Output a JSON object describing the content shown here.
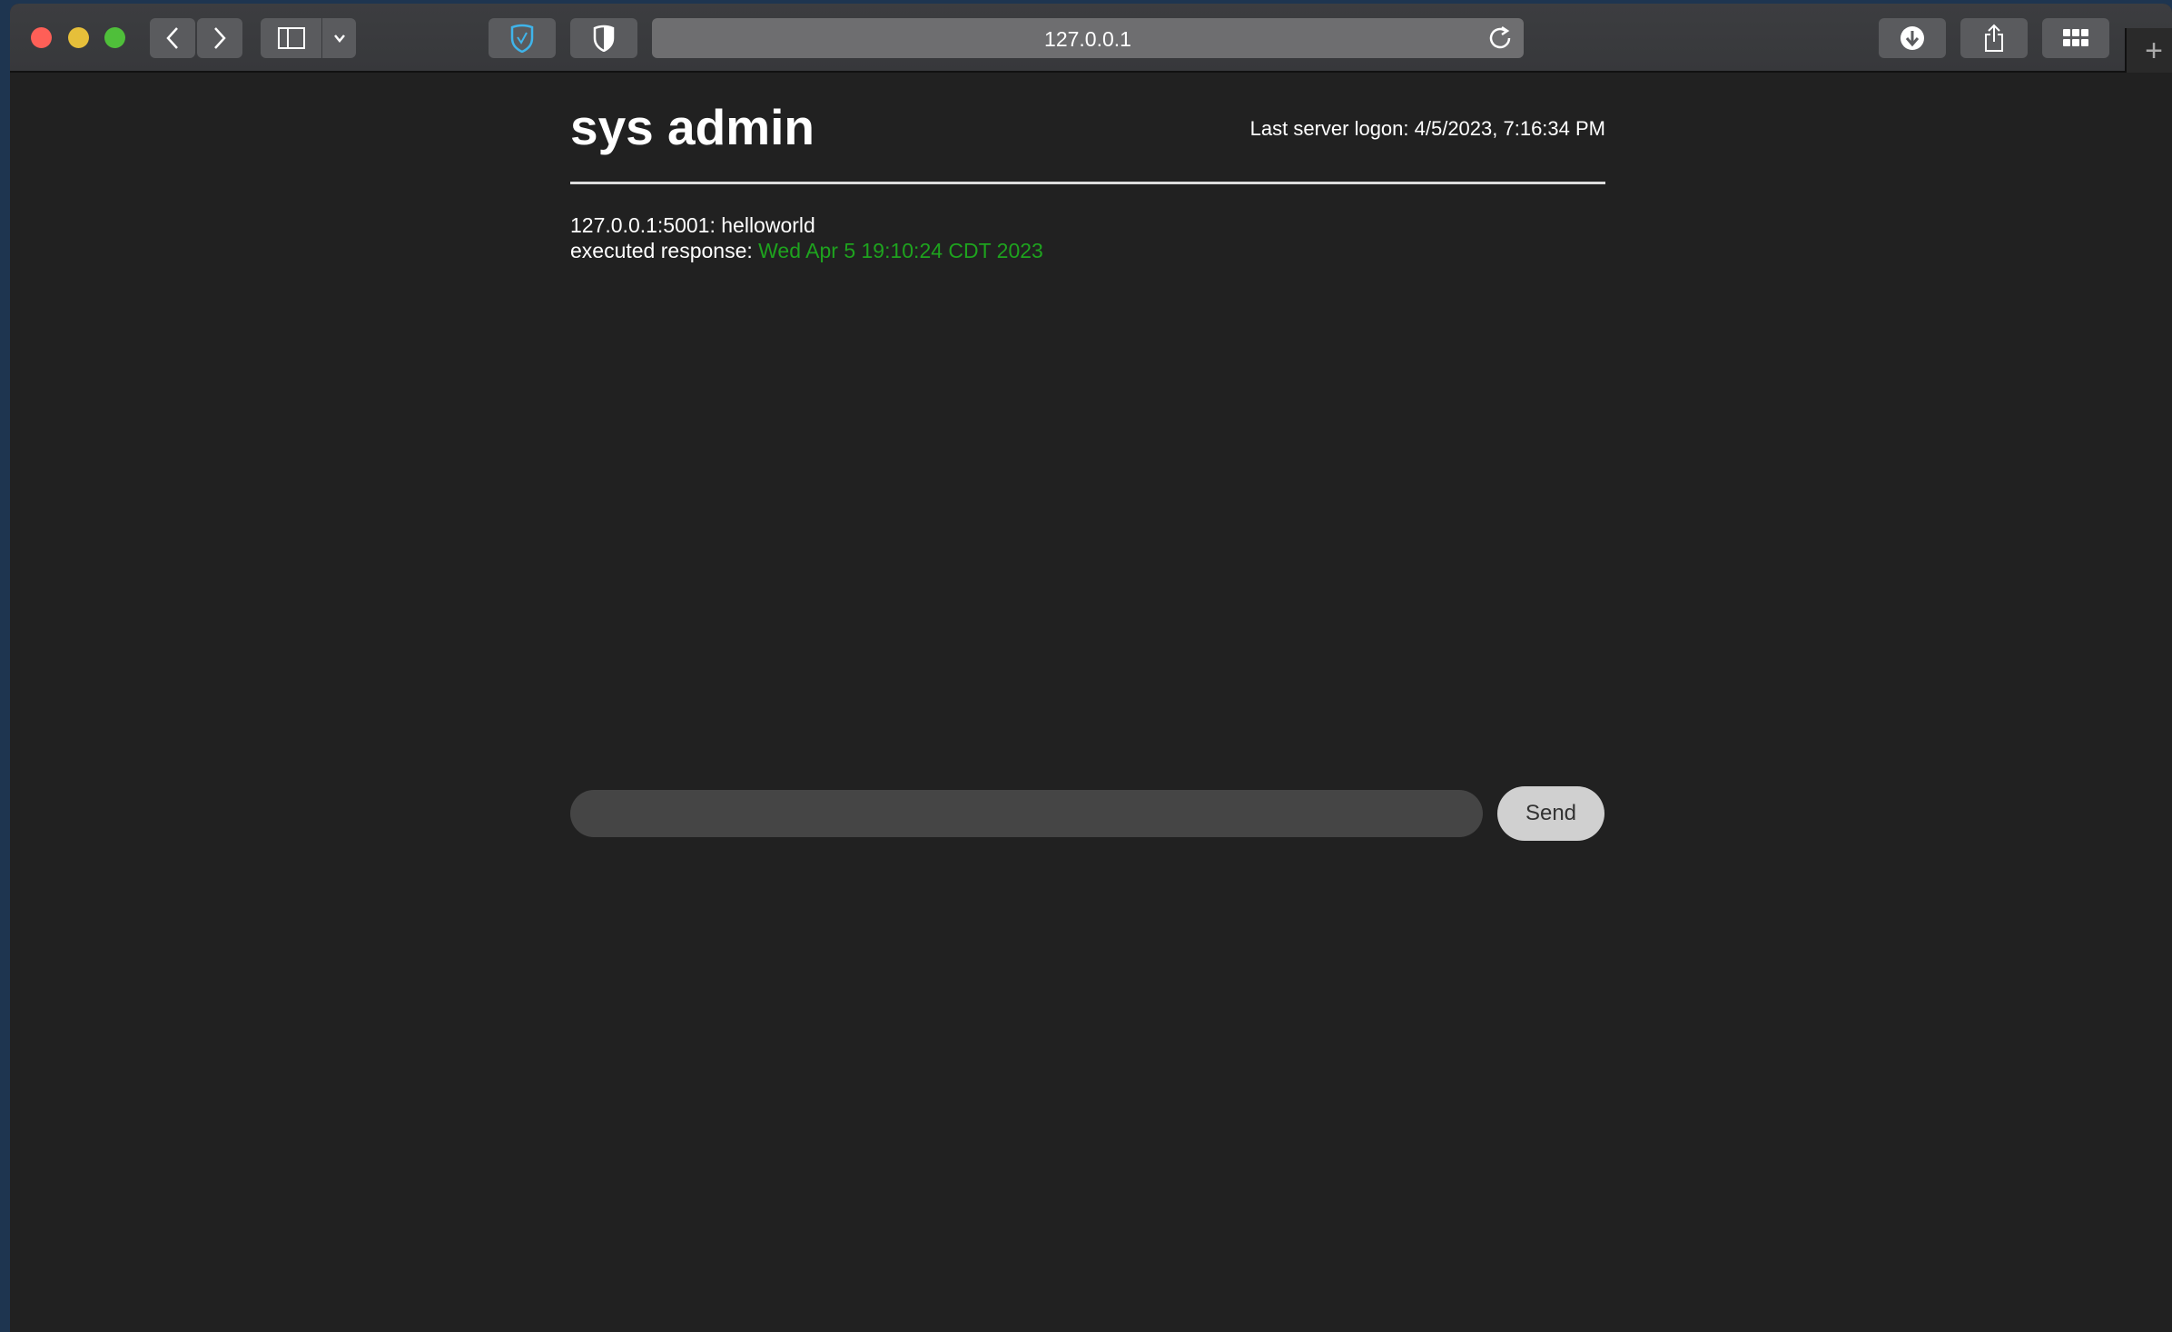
{
  "browser": {
    "url": "127.0.0.1",
    "icons": [
      "close",
      "minimize",
      "maximize",
      "back",
      "forward",
      "sidebar",
      "chevron-down",
      "privacy-shield",
      "shield",
      "reload",
      "download",
      "share",
      "tab-overview",
      "new-tab"
    ],
    "colors": {
      "close": "#fe5f57",
      "minimize": "#e6bf3a",
      "maximize": "#4fbf3a",
      "shield_accent": "#3fb4ea"
    }
  },
  "page": {
    "title": "sys admin",
    "last_logon": "Last server logon: 4/5/2023, 7:16:34 PM",
    "messages": [
      {
        "text": "127.0.0.1:5001: helloworld"
      },
      {
        "label": "executed response: ",
        "value": "Wed Apr 5 19:10:24 CDT 2023"
      }
    ],
    "input_value": "",
    "send_label": "Send",
    "colors": {
      "background": "#212121",
      "response": "#1ea31e"
    }
  }
}
